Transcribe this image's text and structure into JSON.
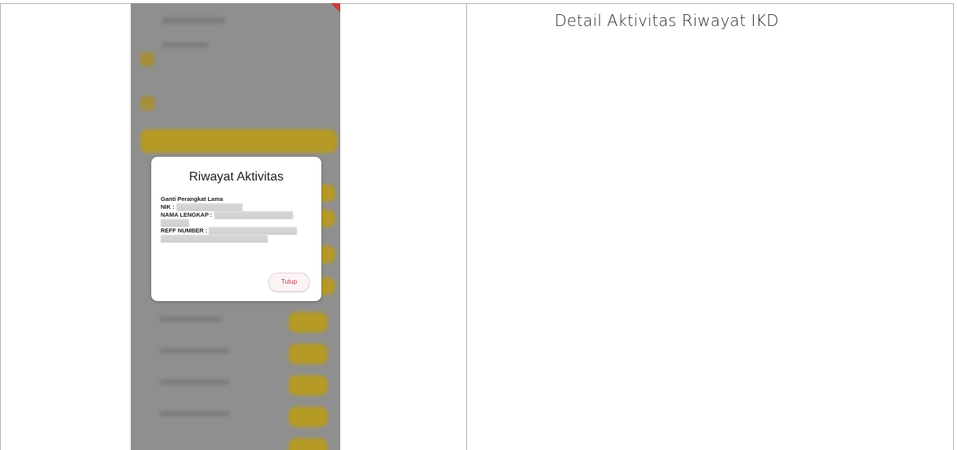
{
  "document": {
    "caption": "Detail Aktivitas Riwayat IKD"
  },
  "dialog": {
    "title": "Riwayat Aktivitas",
    "activity": "Ganti Perangkat Lama",
    "nik_label": "NIK :",
    "nama_label": "NAMA LENGKAP :",
    "reff_label": "REFF NUMBER :",
    "close_label": "Tutup"
  },
  "colors": {
    "overlay": "#8f8f8f",
    "accent_yellow": "#b59a25",
    "close_text": "#c0394b"
  }
}
